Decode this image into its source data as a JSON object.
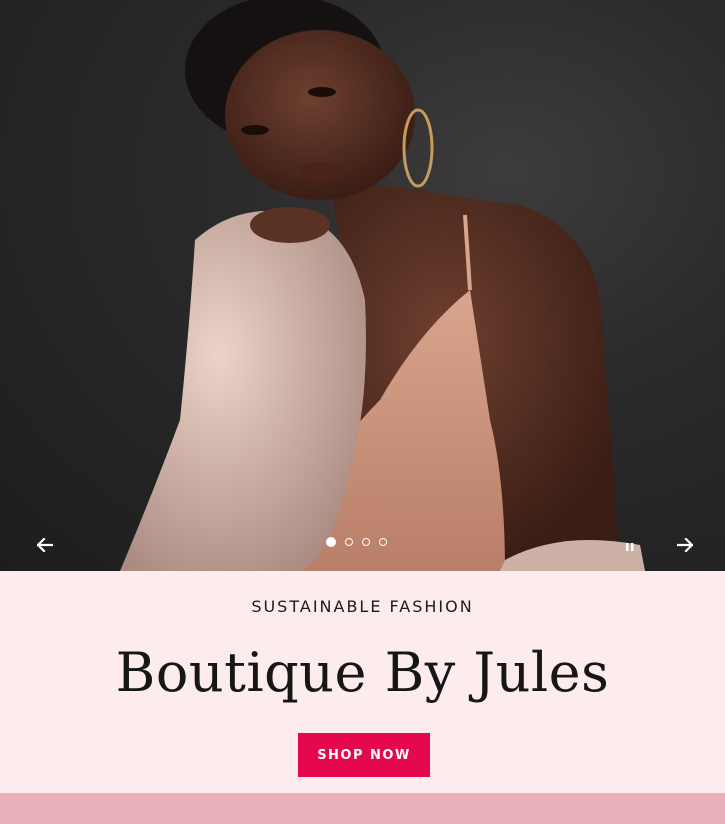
{
  "hero": {
    "slides_total": 4,
    "active_slide": 1,
    "prev_icon": "arrow-left-icon",
    "next_icon": "arrow-right-icon",
    "pause_icon": "pause-icon"
  },
  "banner": {
    "eyebrow": "SUSTAINABLE FASHION",
    "title": "Boutique By Jules",
    "cta_label": "SHOP NOW"
  },
  "colors": {
    "accent": "#e5084f",
    "panel_bg": "#fdeced",
    "band_bg": "#e9b0b9"
  }
}
